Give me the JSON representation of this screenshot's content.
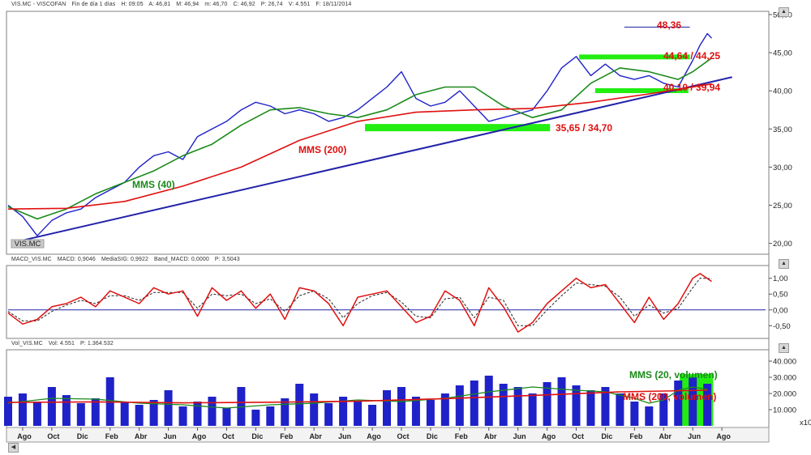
{
  "header": {
    "symbol": "VIS.MC - VISCOFAN",
    "period": "Fin de día 1 días",
    "stats": [
      "H: 09:05",
      "A: 46,81",
      "M: 46,94",
      "m: 46,70",
      "C: 46,92",
      "P: 26,74",
      "V: 4.551",
      "F: 18/11/2014"
    ]
  },
  "macd_header": [
    "MACD_VIS.MC",
    "MACD: 0,9046",
    "MediaSIG: 0,9922",
    "Band_MACD: 0,0000",
    "P: 3,5043"
  ],
  "vol_header": [
    "Vol_VIS.MC",
    "Vol: 4.551",
    "P: 1.364.532"
  ],
  "colors": {
    "price": "#1f22c8",
    "mms40": "#1a8a1a",
    "mms200": "#e01010",
    "trendline": "#2222aa",
    "zone": "#22ee11",
    "annotation_red": "#e01010",
    "annotation_green": "#1a8a1a"
  },
  "chart_data": [
    {
      "type": "line",
      "panel": "price",
      "ylim": [
        19,
        50
      ],
      "yticks": [
        "20,00",
        "25,00",
        "30,00",
        "35,00",
        "40,00",
        "45,00",
        "50,00"
      ],
      "xticks": [
        "Ago",
        "Oct",
        "Dic",
        "Feb",
        "Abr",
        "Jun",
        "Ago",
        "Oct",
        "Dic",
        "Feb",
        "Abr",
        "Jun",
        "Ago",
        "Oct",
        "Dic",
        "Feb",
        "Abr",
        "Jun",
        "Ago",
        "Oct",
        "Dic",
        "Feb",
        "Abr",
        "Jun",
        "Ago"
      ],
      "x_range_months": [
        0,
        52
      ],
      "series": [
        {
          "name": "VIS.MC",
          "x": [
            0,
            1,
            2,
            3,
            4,
            5,
            6,
            7,
            8,
            9,
            10,
            11,
            12,
            13,
            14,
            15,
            16,
            17,
            18,
            19,
            20,
            21,
            22,
            23,
            24,
            25,
            26,
            27,
            28,
            29,
            30,
            31,
            32,
            33,
            34,
            35,
            36,
            37,
            38,
            39,
            40,
            41,
            42,
            43,
            44,
            45,
            46,
            47,
            47.5,
            48,
            48.3
          ],
          "values": [
            25,
            23.5,
            21,
            23,
            24,
            24.5,
            26,
            27,
            28,
            30,
            31.5,
            32,
            31,
            34,
            35,
            36,
            37.5,
            38.5,
            38,
            37,
            37.5,
            37,
            36,
            36.5,
            37.5,
            39,
            40.5,
            42.5,
            39,
            38,
            38.5,
            40,
            38,
            36,
            36.5,
            37,
            37.5,
            40,
            43,
            44.5,
            42,
            43.5,
            42,
            41.5,
            42,
            41,
            40.5,
            44,
            46,
            47.5,
            46.9
          ]
        },
        {
          "name": "MMS (40)",
          "x": [
            0,
            2,
            4,
            6,
            8,
            10,
            12,
            14,
            16,
            18,
            20,
            22,
            24,
            26,
            28,
            30,
            32,
            34,
            36,
            38,
            40,
            42,
            44,
            46,
            47,
            48.3
          ],
          "values": [
            24.8,
            23.2,
            24.5,
            26.5,
            28,
            29.5,
            31.5,
            33,
            35.5,
            37.5,
            37.8,
            37,
            36.5,
            37.5,
            39.5,
            40.5,
            40.5,
            38,
            36.5,
            37.5,
            41,
            43,
            42.5,
            41.5,
            42.5,
            44.3
          ]
        },
        {
          "name": "MMS (200)",
          "x": [
            0,
            4,
            8,
            12,
            16,
            20,
            24,
            28,
            32,
            36,
            40,
            44,
            48.3
          ],
          "values": [
            24.5,
            24.6,
            25.5,
            27.5,
            30,
            33.5,
            36,
            37.2,
            37.5,
            37.7,
            38.5,
            39.6,
            40.9
          ]
        }
      ],
      "trendline": {
        "x": [
          1,
          49.7
        ],
        "values": [
          20.4,
          41.8
        ]
      },
      "zones": [
        {
          "label": "44,64 / 44,25",
          "from_x": 39.2,
          "to_x": 46.8,
          "ymin": 44.25,
          "ymax": 44.64
        },
        {
          "label": "40,10 / 39,94",
          "from_x": 40.3,
          "to_x": 46.7,
          "ymin": 39.94,
          "ymax": 40.1
        },
        {
          "label": "35,65 / 34,70",
          "from_x": 24.5,
          "to_x": 37.2,
          "ymin": 34.7,
          "ymax": 35.65
        }
      ],
      "resistance": {
        "label": "48,36",
        "value": 48.36,
        "from_x": 42.3,
        "to_x": 46.8
      },
      "annotations": [
        "MMS (40)",
        "MMS (200)",
        "48,36",
        "44,64 / 44,25",
        "40,10 / 39,94",
        "35,65 / 34,70"
      ],
      "watermark": "VIS.MC"
    },
    {
      "type": "line",
      "panel": "macd",
      "ylim": [
        -0.8,
        1.3
      ],
      "yticks": [
        "-0,50",
        "0,00",
        "0,50",
        "1,00"
      ],
      "series": [
        {
          "name": "MACD",
          "x": [
            0,
            1,
            2,
            3,
            4,
            5,
            6,
            7,
            8,
            9,
            10,
            11,
            12,
            13,
            14,
            15,
            16,
            17,
            18,
            19,
            20,
            21,
            22,
            23,
            24,
            25,
            26,
            27,
            28,
            29,
            30,
            31,
            32,
            33,
            34,
            35,
            36,
            37,
            38,
            39,
            40,
            41,
            42,
            43,
            44,
            45,
            46,
            47,
            47.5,
            48.3
          ],
          "values": [
            -0.1,
            -0.45,
            -0.3,
            0.1,
            0.2,
            0.4,
            0.1,
            0.6,
            0.4,
            0.2,
            0.7,
            0.5,
            0.6,
            -0.2,
            0.7,
            0.3,
            0.6,
            0.05,
            0.5,
            -0.3,
            0.7,
            0.6,
            0.2,
            -0.5,
            0.4,
            0.5,
            0.6,
            0.1,
            -0.4,
            -0.2,
            0.6,
            0.3,
            -0.5,
            0.7,
            0.1,
            -0.7,
            -0.4,
            0.2,
            0.6,
            1.0,
            0.7,
            0.8,
            0.2,
            -0.4,
            0.4,
            -0.3,
            0.2,
            1.0,
            1.15,
            0.9
          ]
        },
        {
          "name": "MediaSIG",
          "x": [
            0,
            1,
            2,
            3,
            4,
            5,
            6,
            7,
            8,
            9,
            10,
            11,
            12,
            13,
            14,
            15,
            16,
            17,
            18,
            19,
            20,
            21,
            22,
            23,
            24,
            25,
            26,
            27,
            28,
            29,
            30,
            31,
            32,
            33,
            34,
            35,
            36,
            37,
            38,
            39,
            40,
            41,
            42,
            43,
            44,
            45,
            46,
            47,
            47.5,
            48.3
          ],
          "values": [
            -0.05,
            -0.35,
            -0.35,
            -0.05,
            0.15,
            0.3,
            0.2,
            0.45,
            0.45,
            0.3,
            0.55,
            0.55,
            0.55,
            0.05,
            0.5,
            0.45,
            0.5,
            0.2,
            0.35,
            -0.05,
            0.45,
            0.6,
            0.35,
            -0.25,
            0.2,
            0.45,
            0.55,
            0.25,
            -0.2,
            -0.25,
            0.35,
            0.4,
            -0.25,
            0.4,
            0.3,
            -0.5,
            -0.5,
            0.0,
            0.45,
            0.85,
            0.8,
            0.75,
            0.4,
            -0.2,
            0.15,
            -0.1,
            0.05,
            0.7,
            1.0,
            0.99
          ]
        }
      ]
    },
    {
      "type": "bar",
      "panel": "volume",
      "ylim": [
        0,
        45000
      ],
      "yticks": [
        "10.000",
        "20.000",
        "30.000",
        "40.000"
      ],
      "unit_label": "x10",
      "series": [
        {
          "name": "Vol",
          "x": [
            0,
            1,
            2,
            3,
            4,
            5,
            6,
            7,
            8,
            9,
            10,
            11,
            12,
            13,
            14,
            15,
            16,
            17,
            18,
            19,
            20,
            21,
            22,
            23,
            24,
            25,
            26,
            27,
            28,
            29,
            30,
            31,
            32,
            33,
            34,
            35,
            36,
            37,
            38,
            39,
            40,
            41,
            42,
            43,
            44,
            45,
            46,
            47,
            48
          ],
          "values": [
            18000,
            20000,
            15000,
            24000,
            19000,
            14000,
            17000,
            30000,
            15000,
            13000,
            16000,
            22000,
            12000,
            15000,
            18000,
            11000,
            24000,
            10000,
            12000,
            17000,
            26000,
            20000,
            14000,
            18000,
            15000,
            13000,
            22000,
            24000,
            18000,
            16000,
            20000,
            25000,
            28000,
            31000,
            26000,
            24000,
            20000,
            27000,
            30000,
            25000,
            22000,
            24000,
            20000,
            15000,
            12000,
            20000,
            28000,
            30000,
            26000
          ]
        },
        {
          "name": "MMS (20, volumen)",
          "x": [
            0,
            3,
            6,
            9,
            12,
            15,
            18,
            21,
            24,
            27,
            30,
            33,
            36,
            39,
            41,
            43,
            44,
            45,
            46,
            47,
            48
          ],
          "values": [
            14000,
            17000,
            16500,
            14000,
            13000,
            11000,
            13000,
            14000,
            16000,
            15000,
            17000,
            21000,
            24000,
            22000,
            21000,
            17000,
            14000,
            16000,
            22000,
            24000,
            22500
          ]
        },
        {
          "name": "MMS (200, volumen)",
          "x": [
            0,
            6,
            12,
            18,
            24,
            30,
            36,
            42,
            48
          ],
          "values": [
            14500,
            14800,
            14200,
            14600,
            15200,
            16800,
            18800,
            21000,
            22000
          ]
        }
      ],
      "annotations": [
        "MMS (20, volumen)",
        "MMS (200, volumen)"
      ]
    }
  ]
}
